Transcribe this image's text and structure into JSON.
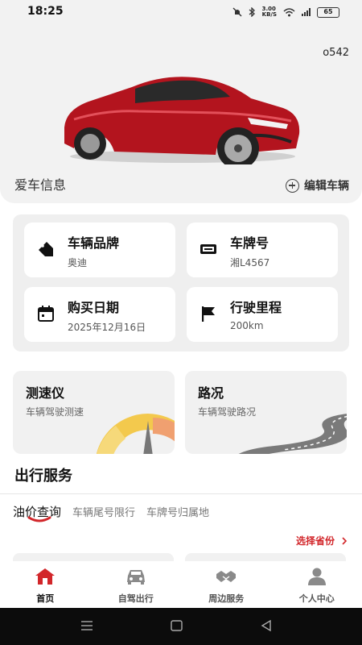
{
  "status": {
    "time": "18:25",
    "speed_value": "3.00",
    "speed_unit": "KB/S",
    "battery": "65"
  },
  "hero": {
    "car_id": "o542",
    "title": "爱车信息",
    "edit_label": "编辑车辆"
  },
  "info": [
    {
      "label": "车辆品牌",
      "value": "奥迪",
      "icon": "tag-icon"
    },
    {
      "label": "车牌号",
      "value": "湘L4567",
      "icon": "license-plate-icon"
    },
    {
      "label": "购买日期",
      "value": "2025年12月16日",
      "icon": "calendar-icon"
    },
    {
      "label": "行驶里程",
      "value": "200km",
      "icon": "flag-icon"
    }
  ],
  "features": [
    {
      "title": "测速仪",
      "subtitle": "车辆驾驶测速"
    },
    {
      "title": "路况",
      "subtitle": "车辆驾驶路况"
    }
  ],
  "services": {
    "title": "出行服务",
    "tabs": [
      "油价查询",
      "车辆尾号限行",
      "车牌号归属地"
    ],
    "active_tab": 0,
    "choose_province": "选择省份"
  },
  "nav": [
    {
      "label": "首页",
      "icon": "home-icon",
      "active": true
    },
    {
      "label": "自驾出行",
      "icon": "car-icon",
      "active": false
    },
    {
      "label": "周边服务",
      "icon": "handshake-icon",
      "active": false
    },
    {
      "label": "个人中心",
      "icon": "person-icon",
      "active": false
    }
  ],
  "colors": {
    "accent": "#d2262a",
    "background": "#f2f2f2",
    "card": "#ffffff"
  }
}
